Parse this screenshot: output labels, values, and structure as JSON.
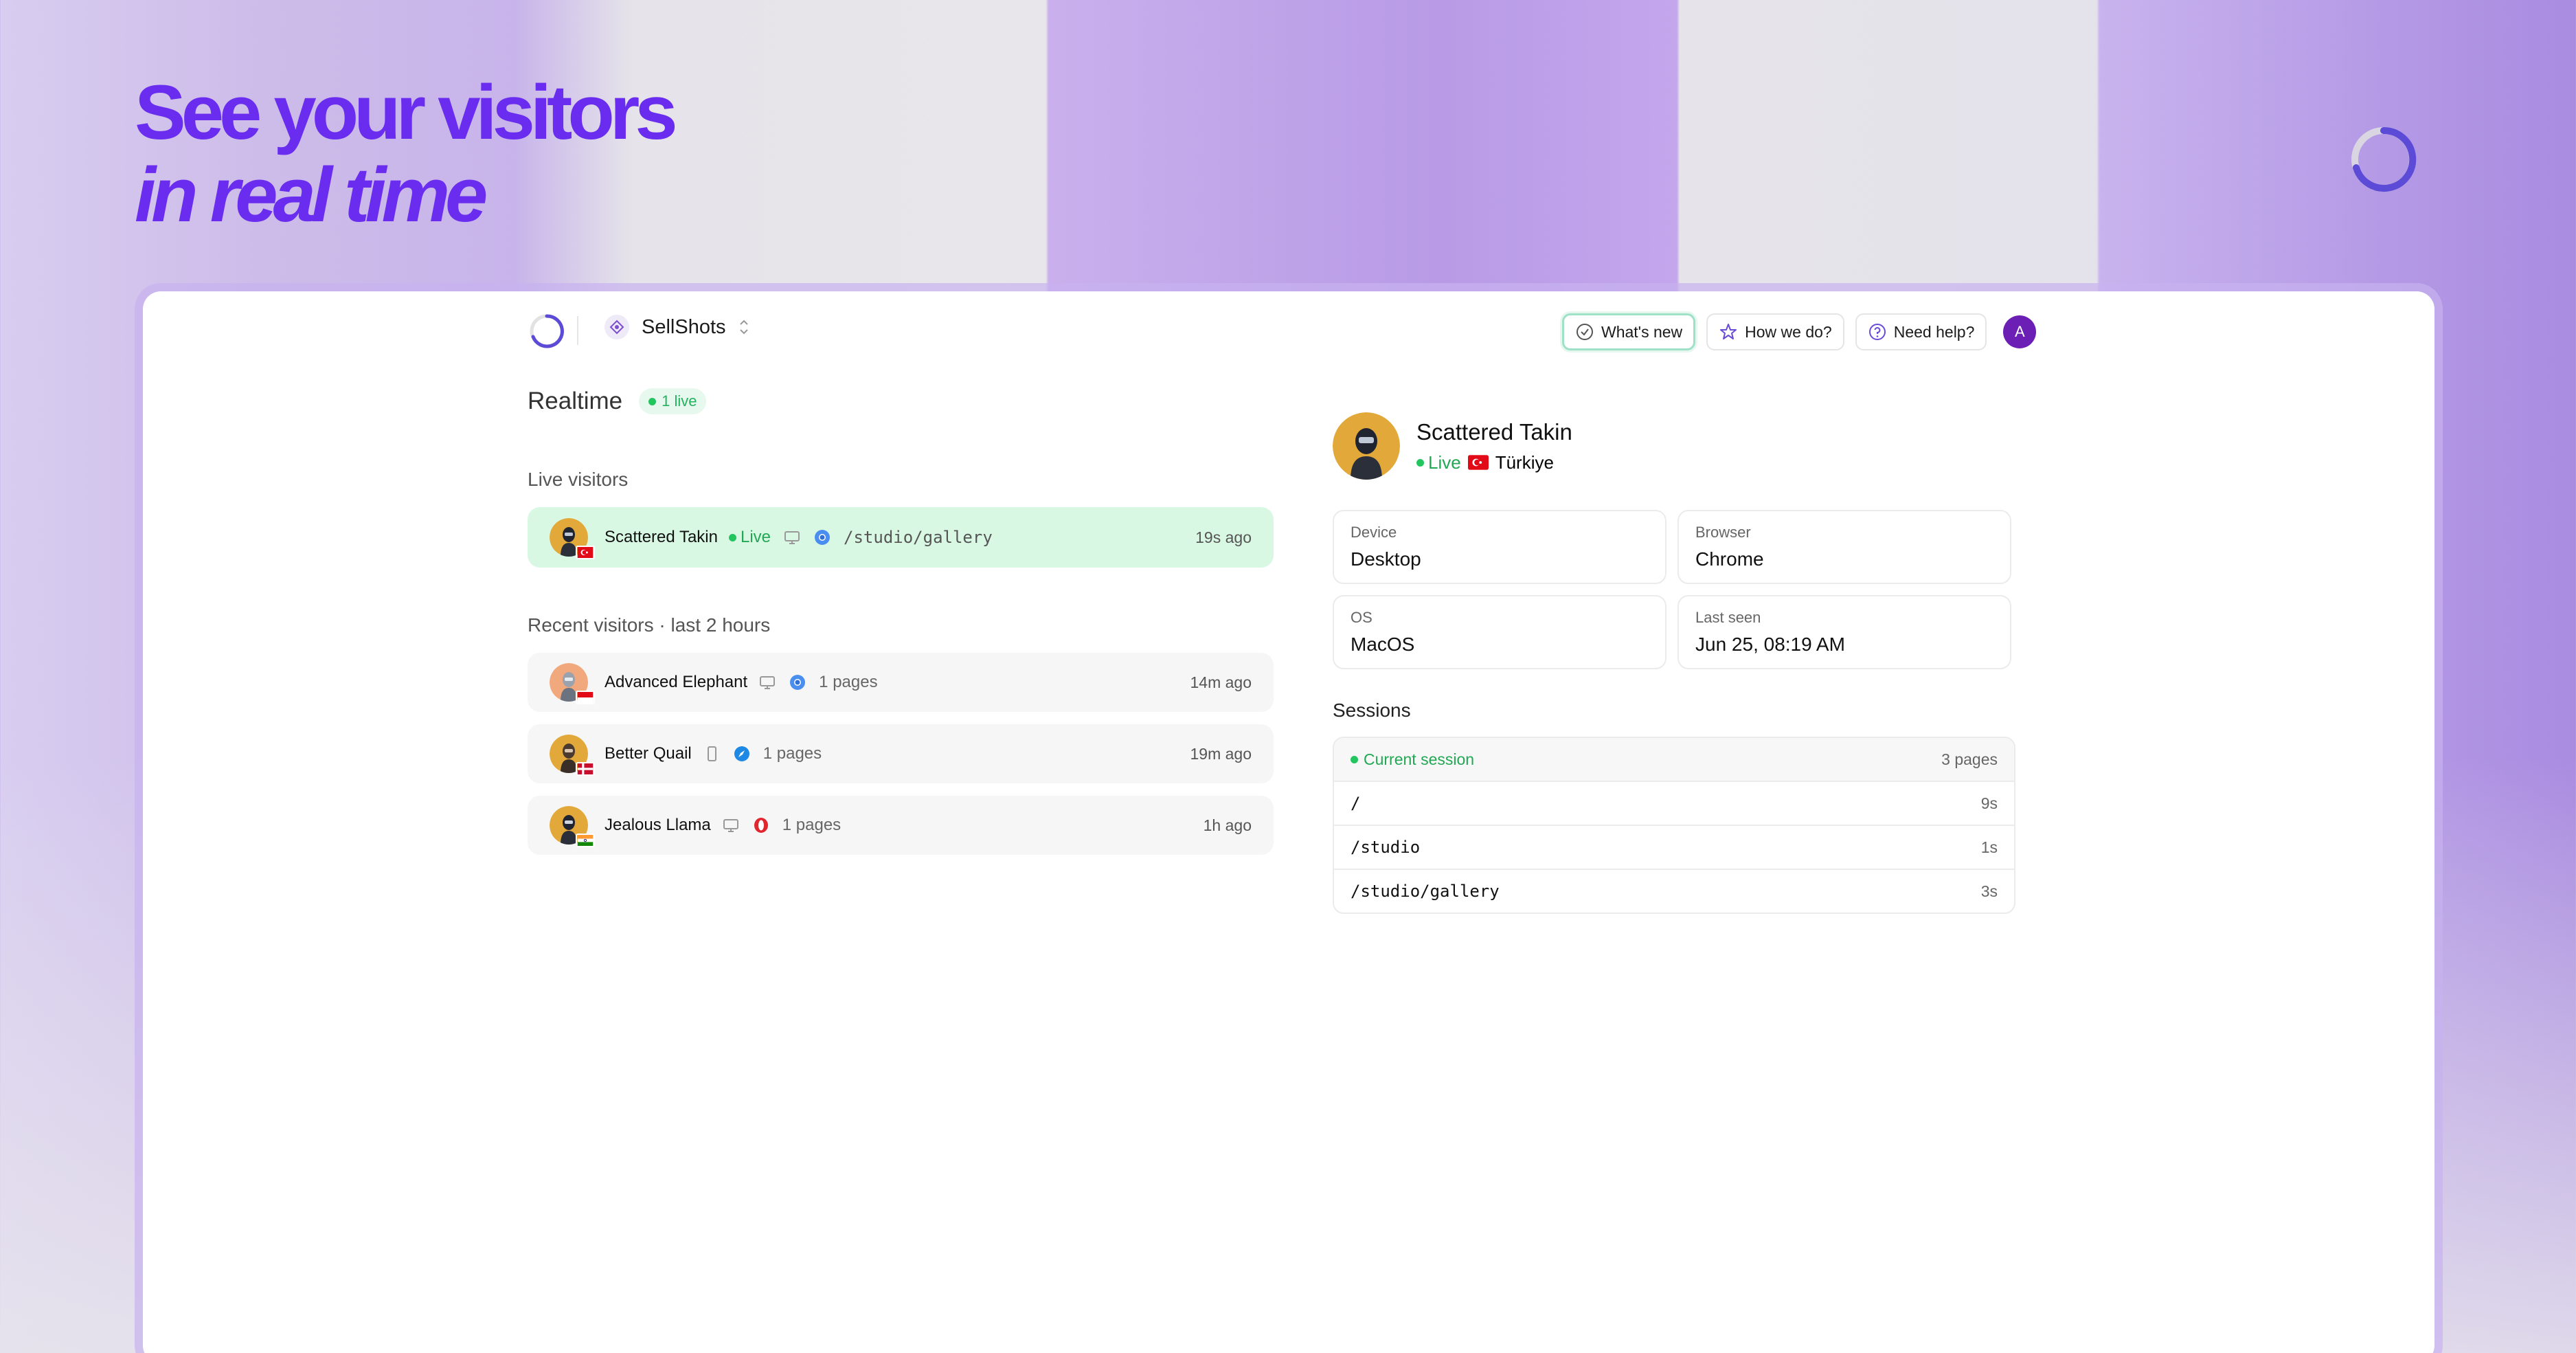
{
  "hero": {
    "line1": "See your visitors",
    "line2": "in real time"
  },
  "topbar": {
    "project_name": "SellShots",
    "buttons": [
      {
        "label": "What's new",
        "icon": "check-circle-icon"
      },
      {
        "label": "How we do?",
        "icon": "star-icon"
      },
      {
        "label": "Need help?",
        "icon": "help-circle-icon"
      }
    ],
    "user_initial": "A"
  },
  "realtime": {
    "title": "Realtime",
    "live_count": "1 live",
    "live_section_label": "Live visitors",
    "recent_section_label": "Recent visitors · last 2 hours",
    "live_visitors": [
      {
        "name": "Scattered Takin",
        "status": "Live",
        "device": "desktop-icon",
        "browser": "chrome-icon",
        "path": "/studio/gallery",
        "ago": "19s ago",
        "flag": "tr"
      }
    ],
    "recent_visitors": [
      {
        "name": "Advanced Elephant",
        "device": "desktop-icon",
        "browser": "chrome-icon",
        "pages": "1 pages",
        "ago": "14m ago",
        "flag": "id"
      },
      {
        "name": "Better Quail",
        "device": "mobile-icon",
        "browser": "safari-icon",
        "pages": "1 pages",
        "ago": "19m ago",
        "flag": "dk"
      },
      {
        "name": "Jealous Llama",
        "device": "desktop-icon",
        "browser": "opera-icon",
        "pages": "1 pages",
        "ago": "1h ago",
        "flag": "in"
      }
    ]
  },
  "detail": {
    "name": "Scattered Takin",
    "status": "Live",
    "country": "Türkiye",
    "cards": [
      {
        "label": "Device",
        "value": "Desktop"
      },
      {
        "label": "Browser",
        "value": "Chrome"
      },
      {
        "label": "OS",
        "value": "MacOS"
      },
      {
        "label": "Last seen",
        "value": "Jun 25, 08:19 AM"
      }
    ],
    "sessions_title": "Sessions",
    "current_session_label": "Current session",
    "current_session_pages": "3 pages",
    "session_pages": [
      {
        "path": "/",
        "duration": "9s"
      },
      {
        "path": "/studio",
        "duration": "1s"
      },
      {
        "path": "/studio/gallery",
        "duration": "3s"
      }
    ]
  },
  "colors": {
    "accent": "#6a2df0",
    "live_green": "#22c55e",
    "live_row_bg": "#d9f8e4",
    "avatar_purple": "#6b1fb5"
  }
}
